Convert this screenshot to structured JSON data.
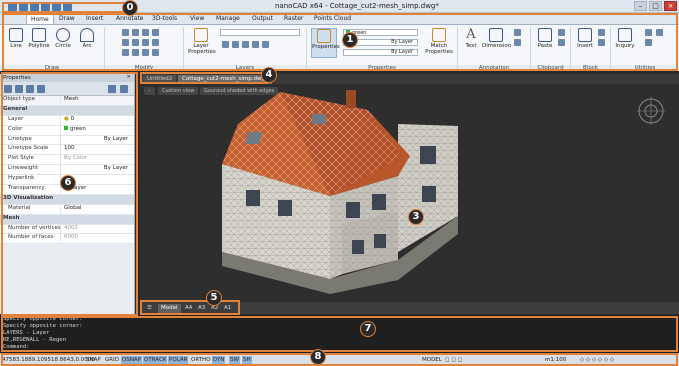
{
  "app": {
    "title": "nanoCAD x64 - Cottage_cut2-mesh_simp.dwg*"
  },
  "ribbon": {
    "tabs": [
      "Home",
      "Draw",
      "Insert",
      "Annotate",
      "3D-tools",
      "View",
      "Manage",
      "Output",
      "Raster",
      "Points Cloud"
    ],
    "active_tab": "Home",
    "groups": [
      "Draw",
      "Modify",
      "Layers",
      "Properties",
      "Annotation",
      "Clipboard",
      "Block",
      "Utilities"
    ],
    "draw_buttons": [
      "Line",
      "Polyline",
      "Circle",
      "Arc"
    ],
    "layer_properties": "Layer Properties",
    "properties_button": "Properties",
    "layer_combo": "green",
    "bylayer_1": "By Layer",
    "bylayer_2": "By Layer",
    "match_properties": "Match Properties",
    "text_button": "Text",
    "dimension_button": "Dimension",
    "paste_button": "Paste",
    "insert_button": "Insert",
    "inquiry_button": "Inquiry"
  },
  "properties_panel": {
    "title": "Properties",
    "object_type_label": "Object type",
    "object_type_value": "Mesh",
    "sections": {
      "general": "General",
      "visualization": "3D Visualization",
      "mesh": "Mesh"
    },
    "general_rows": [
      {
        "key": "Layer",
        "value": "0"
      },
      {
        "key": "Color",
        "value": "green"
      },
      {
        "key": "Linetype",
        "value": "By Layer"
      },
      {
        "key": "Linetype Scale",
        "value": "100"
      },
      {
        "key": "Plot Style",
        "value": "By Color"
      },
      {
        "key": "Lineweight",
        "value": "By Layer"
      },
      {
        "key": "Hyperlink",
        "value": ""
      },
      {
        "key": "Transparency",
        "value": "ByLayer"
      }
    ],
    "visualization_rows": [
      {
        "key": "Material",
        "value": "Global"
      }
    ],
    "mesh_rows": [
      {
        "key": "Number of vertices",
        "value": "4002"
      },
      {
        "key": "Number of faces",
        "value": "6000"
      }
    ]
  },
  "documents": {
    "tabs": [
      "Untitled2",
      "Cottage_cut2-mesh_simp.dwg*"
    ],
    "active": "Cottage_cut2-mesh_simp.dwg*"
  },
  "viewport": {
    "view_label": "Custom view",
    "style_label": "Gouraud shaded with edges"
  },
  "layouts": {
    "tabs": [
      "Model",
      "A4",
      "A3",
      "A2",
      "A1"
    ],
    "active": "Model"
  },
  "command_line": {
    "lines": [
      "Specify opposite corner:",
      "Specify opposite corner:",
      "LAYERS - Layer",
      "RE,REGENALL - Regen",
      "Command:"
    ]
  },
  "status_bar": {
    "coordinates": "47583.1889,109518.8643,0.0000",
    "toggles": [
      {
        "label": "SNAP",
        "on": false
      },
      {
        "label": "GRID",
        "on": false
      },
      {
        "label": "OSNAP",
        "on": true
      },
      {
        "label": "OTRACK",
        "on": true
      },
      {
        "label": "POLAR",
        "on": true
      },
      {
        "label": "ORTHO",
        "on": false
      },
      {
        "label": "DYN",
        "on": true
      },
      {
        "label": "SW",
        "on": true
      },
      {
        "label": "SH",
        "on": true
      }
    ],
    "model_label": "MODEL",
    "scale": "m1:100"
  },
  "callouts": [
    "0",
    "1",
    "3",
    "4",
    "5",
    "6",
    "7",
    "8"
  ],
  "colors": {
    "accent_frame": "#e0823a",
    "badge_bg": "#2a2a2a",
    "toggle_on": "#8fb2d8",
    "layer_green": "#2fb52f"
  }
}
